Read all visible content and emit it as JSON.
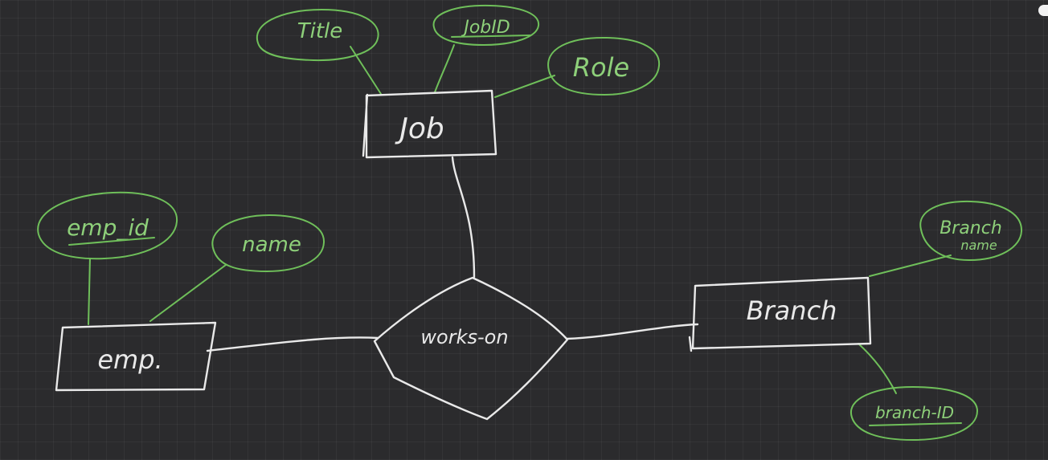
{
  "diagram": {
    "entities": {
      "job": "Job",
      "emp": "emp.",
      "branch": "Branch"
    },
    "relationship": "works-on",
    "attributes": {
      "title": "Title",
      "job_id": "JobID",
      "role": "Role",
      "emp_id": "emp_id",
      "name": "name",
      "branch_name_line1": "Branch",
      "branch_name_line2": "name",
      "branch_id": "branch-ID"
    }
  }
}
